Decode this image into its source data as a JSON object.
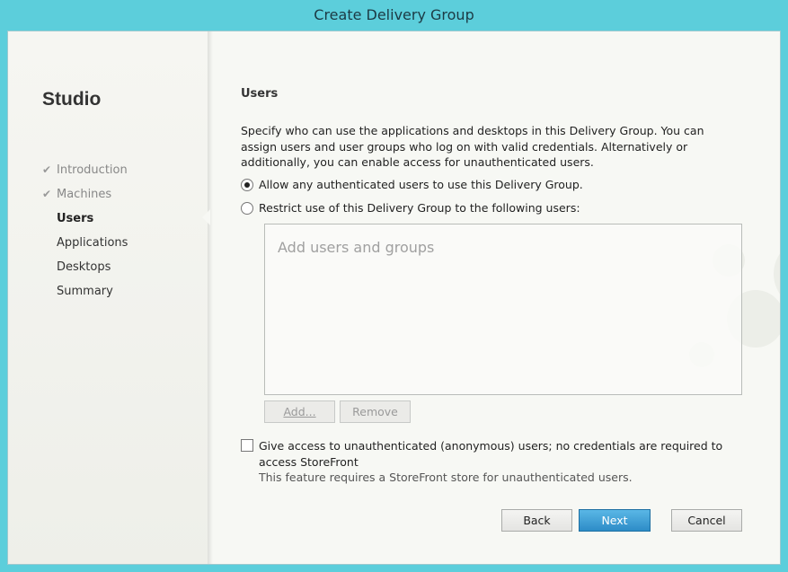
{
  "window": {
    "title": "Create Delivery Group"
  },
  "sidebar": {
    "brand": "Studio",
    "steps": [
      {
        "label": "Introduction",
        "state": "done"
      },
      {
        "label": "Machines",
        "state": "done"
      },
      {
        "label": "Users",
        "state": "active"
      },
      {
        "label": "Applications",
        "state": "pending"
      },
      {
        "label": "Desktops",
        "state": "pending"
      },
      {
        "label": "Summary",
        "state": "pending"
      }
    ],
    "check_glyph": "✔"
  },
  "main": {
    "title": "Users",
    "description": "Specify who can use the applications and desktops in this Delivery Group. You can assign users and user groups who log on with valid credentials. Alternatively or additionally, you can enable access for unauthenticated users.",
    "radio_allow": {
      "label": "Allow any authenticated users to use this Delivery Group.",
      "selected": true
    },
    "radio_restrict": {
      "label": "Restrict use of this Delivery Group to the following users:",
      "selected": false
    },
    "users_box": {
      "placeholder": "Add users and groups"
    },
    "add_button": "Add...",
    "remove_button": "Remove",
    "anon_checkbox": {
      "label": "Give access to unauthenticated (anonymous) users; no credentials are required to access StoreFront",
      "checked": false
    },
    "anon_note": "This feature requires a StoreFront store for unauthenticated users."
  },
  "footer": {
    "back": "Back",
    "next": "Next",
    "cancel": "Cancel"
  },
  "colors": {
    "frame": "#5ccedb",
    "primary_button": "#2d8cc7"
  }
}
